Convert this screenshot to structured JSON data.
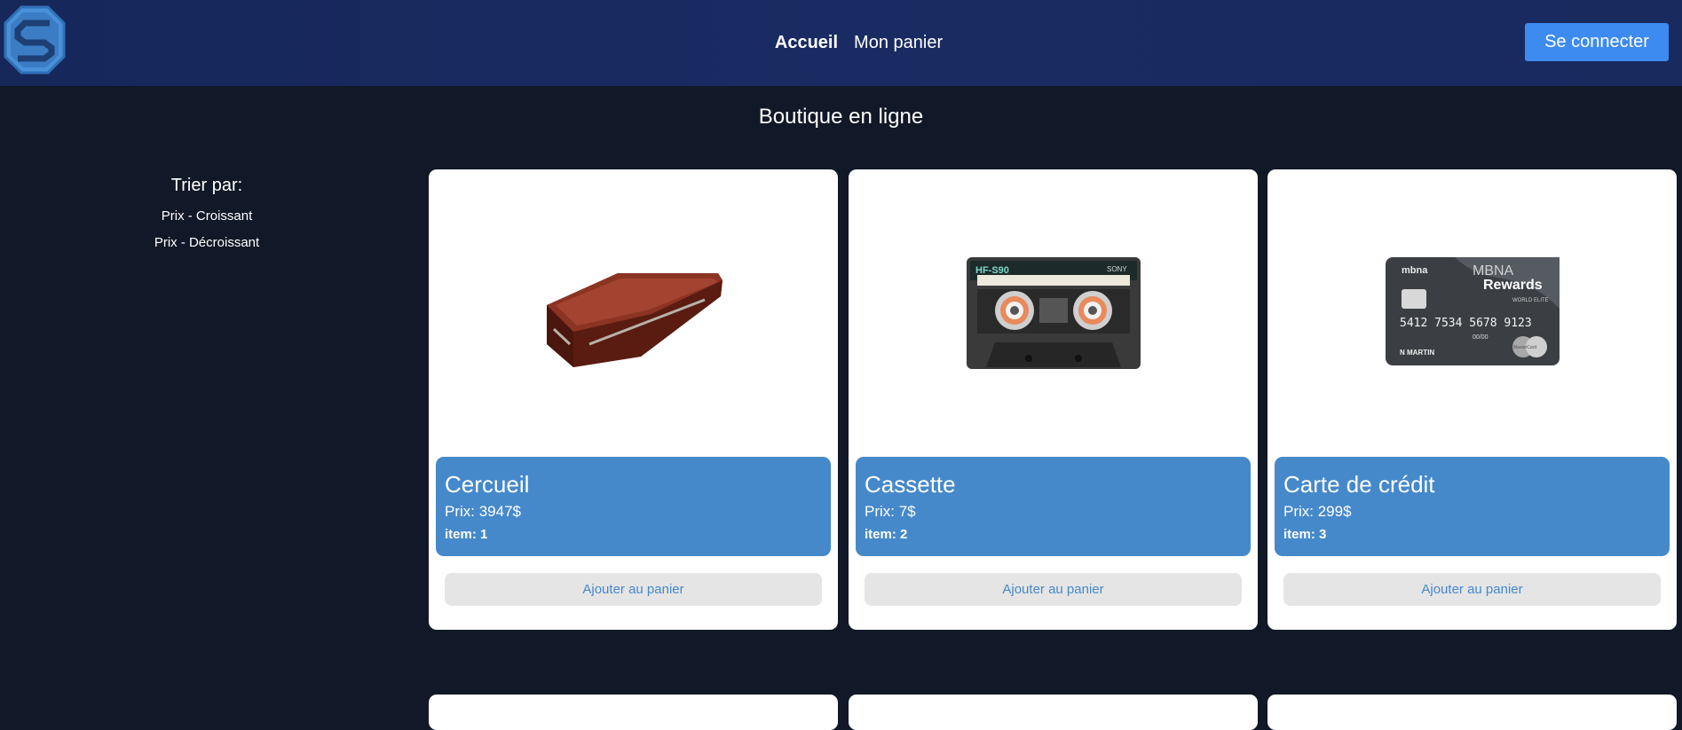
{
  "header": {
    "nav": [
      {
        "label": "Accueil"
      },
      {
        "label": "Mon panier"
      }
    ],
    "login_label": "Se connecter"
  },
  "page_title": "Boutique en ligne",
  "sort": {
    "title": "Trier par:",
    "options": [
      {
        "label": "Prix - Croissant"
      },
      {
        "label": "Prix - Décroissant"
      }
    ]
  },
  "products": [
    {
      "name": "Cercueil",
      "price": "Prix: 3947$",
      "item": "item: 1",
      "image": "coffin-image",
      "add_label": "Ajouter au panier"
    },
    {
      "name": "Cassette",
      "price": "Prix: 7$",
      "item": "item: 2",
      "image": "cassette-image",
      "add_label": "Ajouter au panier"
    },
    {
      "name": "Carte de crédit",
      "price": "Prix: 299$",
      "item": "item: 3",
      "image": "credit-card-image",
      "add_label": "Ajouter au panier"
    }
  ],
  "cassette_labels": {
    "model": "HF-S90",
    "brand": "SONY"
  },
  "card_labels": {
    "bank": "mbna",
    "brand": "MBNA",
    "program": "Rewards",
    "tier": "WORLD ELITE",
    "number": "5412 7534 5678 9123",
    "expiry": "00/00",
    "holder": "N MARTIN",
    "network": "MasterCard"
  },
  "colors": {
    "background": "#111827",
    "header": "#1a2b63",
    "accent": "#3d8bf0",
    "card_info": "#4589cb"
  }
}
